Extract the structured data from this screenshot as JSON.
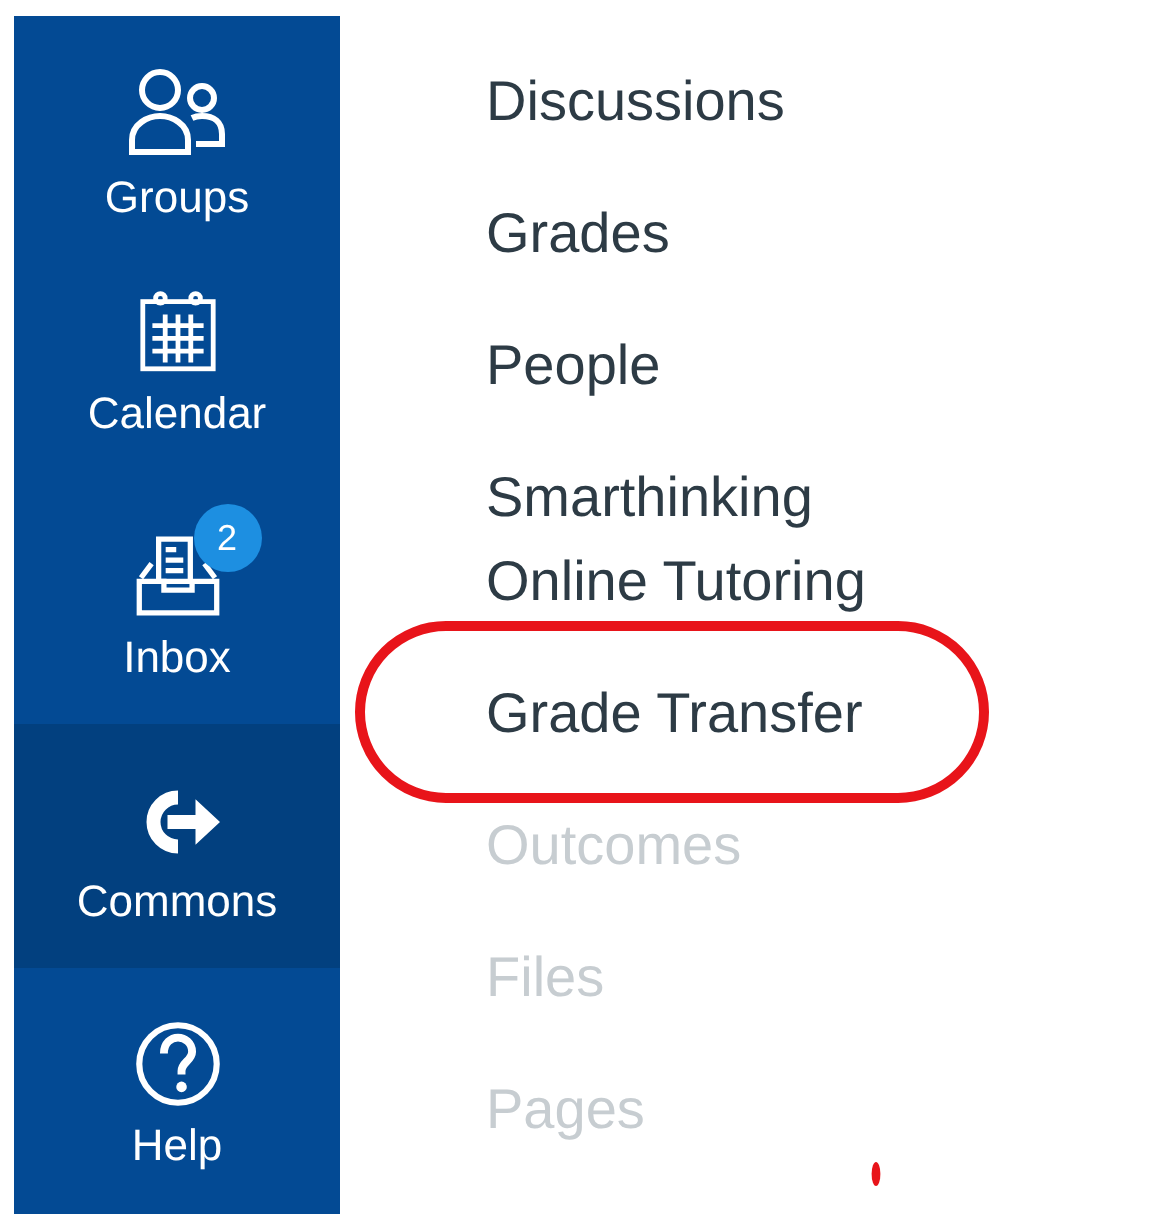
{
  "global_nav": [
    {
      "kind": "groups",
      "label": "Groups",
      "selected": false
    },
    {
      "kind": "calendar",
      "label": "Calendar",
      "selected": false
    },
    {
      "kind": "inbox",
      "label": "Inbox",
      "selected": false,
      "badge": "2"
    },
    {
      "kind": "commons",
      "label": "Commons",
      "selected": true
    },
    {
      "kind": "help",
      "label": "Help",
      "selected": false
    }
  ],
  "course_nav": [
    {
      "label": "Discussions",
      "disabled": false,
      "highlighted": false
    },
    {
      "label": "Grades",
      "disabled": false,
      "highlighted": false
    },
    {
      "label": "People",
      "disabled": false,
      "highlighted": false
    },
    {
      "label": "Smarthinking Online Tutoring",
      "disabled": false,
      "highlighted": false
    },
    {
      "label": "Grade Transfer",
      "disabled": false,
      "highlighted": true
    },
    {
      "label": "Outcomes",
      "disabled": true,
      "highlighted": false
    },
    {
      "label": "Files",
      "disabled": true,
      "highlighted": false
    },
    {
      "label": "Pages",
      "disabled": true,
      "highlighted": false
    }
  ]
}
